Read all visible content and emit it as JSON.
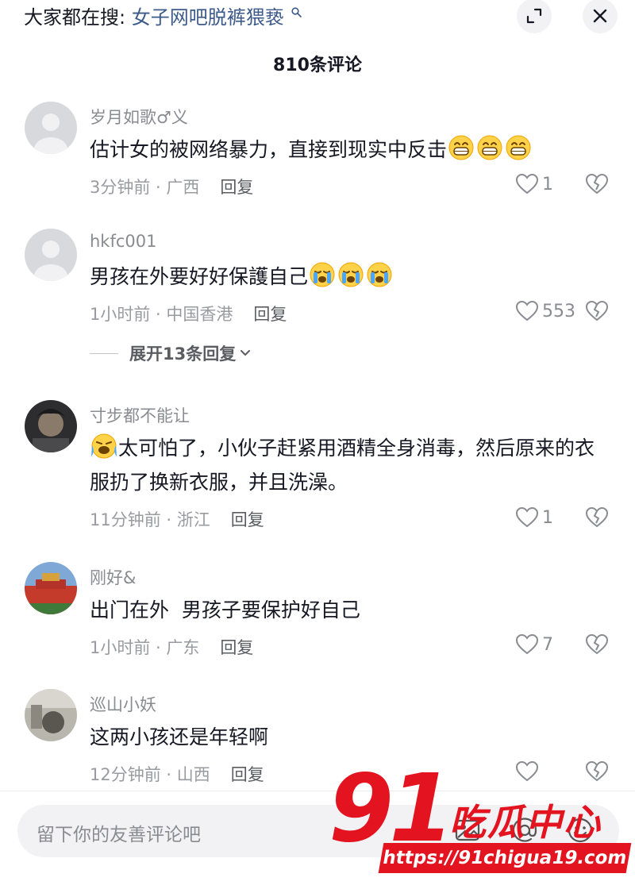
{
  "header": {
    "search_prefix": "大家都在搜:",
    "search_keyword": "女子网吧脱裤猥亵",
    "comment_count": "810条评论"
  },
  "comments": [
    {
      "username": "岁月如歌♂义",
      "text": "估计女的被网络暴力，直接到现实中反击",
      "emoji": [
        "grin-emoji",
        "grin-emoji",
        "grin-emoji"
      ],
      "time": "3分钟前 · 广西",
      "reply": "回复",
      "likes": "1"
    },
    {
      "username": "hkfc001",
      "text": "男孩在外要好好保護自己",
      "emoji": [
        "crying-emoji",
        "crying-emoji",
        "crying-emoji"
      ],
      "time": "1小时前 · 中国香港",
      "reply": "回复",
      "likes": "553"
    },
    {
      "username": "寸步都不能让",
      "text": "太可怕了，小伙子赶紧用酒精全身消毒，然后原来的衣服扔了换新衣服，并且洗澡。",
      "time": "11分钟前 · 浙江",
      "reply": "回复",
      "likes": "1"
    },
    {
      "username": "刚好&",
      "text": "出门在外  男孩子要保护好自己",
      "time": "1小时前 · 广东",
      "reply": "回复",
      "likes": "7"
    },
    {
      "username": "巡山小妖",
      "text": "这两小孩还是年轻啊",
      "time": "12分钟前 · 山西",
      "reply": "回复",
      "likes": ""
    }
  ],
  "expand_replies": "展开13条回复",
  "input": {
    "placeholder": "留下你的友善评论吧"
  },
  "watermark": {
    "number": "91",
    "title": "吃瓜中心",
    "url": "https://91chigua19.com"
  },
  "colors": {
    "keyword": "#3c5a8a",
    "watermark_red": "#e3131f",
    "meta_gray": "#9a9ba1"
  }
}
